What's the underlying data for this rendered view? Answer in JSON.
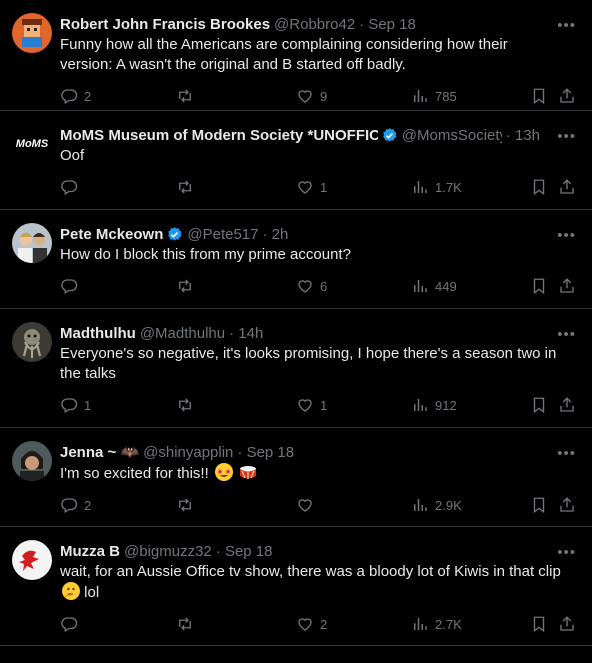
{
  "colors": {
    "background": "#000000",
    "text": "#e7e9ea",
    "muted": "#71767b",
    "verified": "#1d9bf0",
    "divider": "#2f3336"
  },
  "tweets": [
    {
      "name": "Robert John Francis Brookes",
      "handle": "@Robbro42",
      "time": "· Sep 18",
      "text": "Funny how all the Americans are complaining considering how their version: A wasn't the original and B started off badly.",
      "replies": "2",
      "retweets": "",
      "likes": "9",
      "views": "785"
    },
    {
      "name": "MoMS Museum of Modern Society *UNOFFICI/",
      "handle": "@MomsSociety",
      "time": "· 13h",
      "avatar_text": "MoMS",
      "text": "Oof",
      "replies": "",
      "retweets": "",
      "likes": "1",
      "views": "1.7K"
    },
    {
      "name": "Pete Mckeown",
      "handle": "@Pete517",
      "time": "· 2h",
      "text": "How do I block this from my prime account?",
      "replies": "",
      "retweets": "",
      "likes": "6",
      "views": "449"
    },
    {
      "name": "Madthulhu",
      "handle": "@Madthulhu",
      "time": "· 14h",
      "text": "Everyone's so negative, it's looks promising, I hope there's a season two in the talks",
      "replies": "1",
      "retweets": "",
      "likes": "1",
      "views": "912"
    },
    {
      "name": "Jenna ~ 🦇",
      "handle": "@shinyapplin",
      "time": "· Sep 18",
      "text": "I'm so excited for this!!",
      "replies": "2",
      "retweets": "",
      "likes": "",
      "views": "2.9K"
    },
    {
      "name": "Muzza B",
      "handle": "@bigmuzz32",
      "time": "· Sep 18",
      "text": "wait, for an Aussie Office tv show, there was a bloody lot of Kiwis in that clip",
      "text_suffix": "lol",
      "replies": "",
      "retweets": "",
      "likes": "2",
      "views": "2.7K"
    }
  ],
  "icons": [
    "reply-icon",
    "retweet-icon",
    "like-icon",
    "views-icon",
    "bookmark-icon",
    "share-icon",
    "more-icon",
    "verified-icon"
  ]
}
